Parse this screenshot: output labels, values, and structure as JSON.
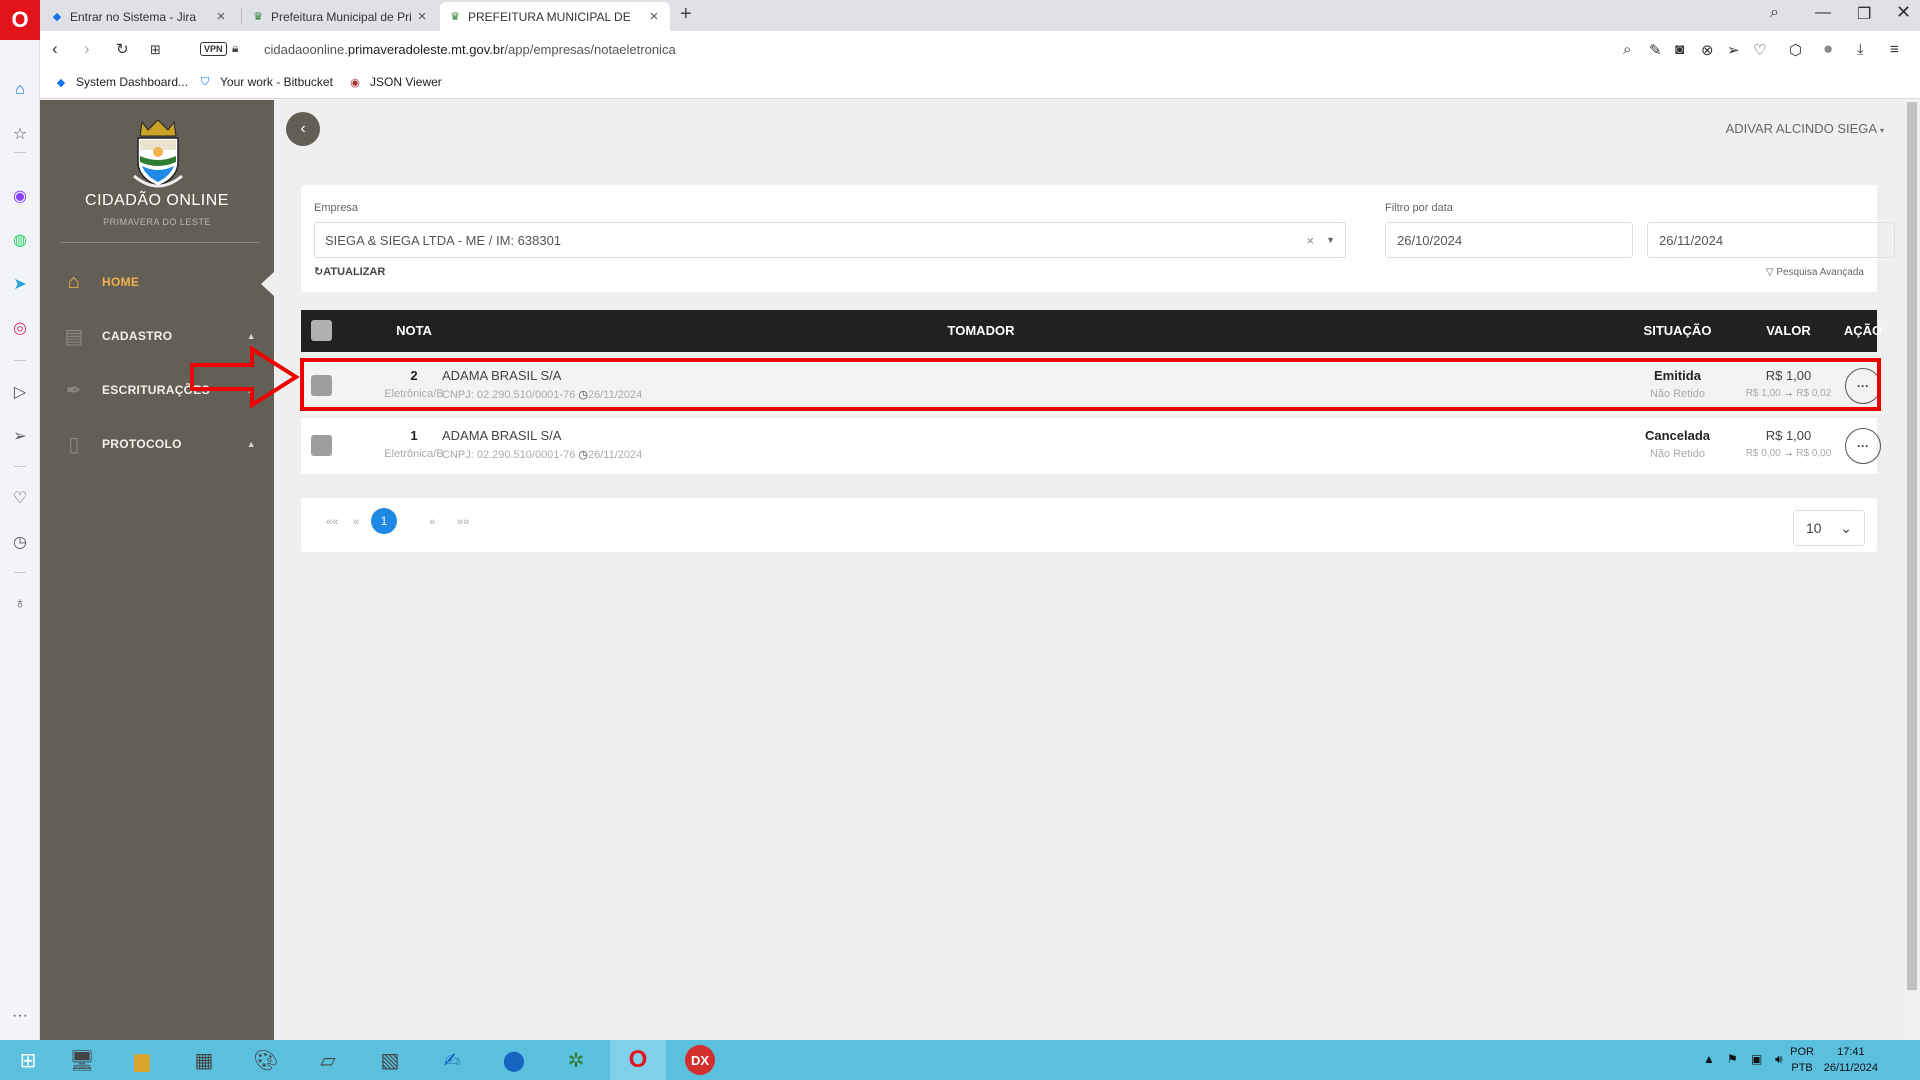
{
  "browser": {
    "tabs": [
      {
        "title": "Entrar no Sistema - Jira",
        "icon": "jira-icon"
      },
      {
        "title": "Prefeitura Municipal de Pri",
        "icon": "crest-icon"
      },
      {
        "title": "PREFEITURA MUNICIPAL DE",
        "icon": "crest-icon"
      }
    ],
    "url_prefix": "cidadaoonline.",
    "url_domain": "primaveradoleste.mt.gov.br",
    "url_path": "/app/empresas/notaeletronica",
    "vpn_label": "VPN",
    "bookmarks": [
      {
        "label": "System Dashboard...",
        "icon": "jira-icon"
      },
      {
        "label": "Your work - Bitbucket",
        "icon": "bitbucket-icon"
      },
      {
        "label": "JSON Viewer",
        "icon": "json-viewer-icon"
      }
    ]
  },
  "sidebar": {
    "title": "CIDADÃO ONLINE",
    "subtitle": "PRIMAVERA DO LESTE",
    "items": [
      {
        "label": "HOME",
        "icon": "home-icon",
        "active": true
      },
      {
        "label": "CADASTRO",
        "icon": "register-icon"
      },
      {
        "label": "ESCRITURAÇÕES",
        "icon": "pen-icon"
      },
      {
        "label": "PROTOCOLO",
        "icon": "document-icon"
      }
    ],
    "caret": "▲"
  },
  "header": {
    "user": "ADIVAR ALCINDO SIEGA"
  },
  "filters": {
    "empresa_label": "Empresa",
    "empresa_value": "SIEGA & SIEGA LTDA - ME / IM: 638301",
    "date_label": "Filtro por data",
    "date_from": "26/10/2024",
    "date_to": "26/11/2024",
    "refresh_label": "ATUALIZAR",
    "advanced_label": "Pesquisa Avançada"
  },
  "table": {
    "headers": {
      "nota": "NOTA",
      "tomador": "TOMADOR",
      "situacao": "SITUAÇÃO",
      "valor": "VALOR",
      "acao": "AÇÃO"
    },
    "rows": [
      {
        "nota": "2",
        "tipo": "Eletrônica/B",
        "tomador": "ADAMA BRASIL S/A",
        "cnpj": "CNPJ: 02.290.510/0001-76",
        "data": "26/11/2024",
        "situacao": "Emitida",
        "retencao": "Não Retido",
        "valor": "R$ 1,00",
        "valor_de": "R$ 1,00",
        "valor_para": "R$ 0,02"
      },
      {
        "nota": "1",
        "tipo": "Eletrônica/B",
        "tomador": "ADAMA BRASIL S/A",
        "cnpj": "CNPJ: 02.290.510/0001-76",
        "data": "26/11/2024",
        "situacao": "Cancelada",
        "retencao": "Não Retido",
        "valor": "R$ 1,00",
        "valor_de": "R$ 0,00",
        "valor_para": "R$ 0,00"
      }
    ]
  },
  "pagination": {
    "first": "««",
    "prev": "«",
    "current": "1",
    "next": "»",
    "last": "»»",
    "per_page": "10"
  },
  "taskbar": {
    "lang1": "POR",
    "lang2": "PTB",
    "time": "17:41",
    "date": "26/11/2024"
  },
  "colors": {
    "sidebar_bg": "#645f56",
    "accent_active": "#f1b04a",
    "table_header": "#212121",
    "pager_active": "#1e88e5",
    "highlight": "#ee0000"
  }
}
